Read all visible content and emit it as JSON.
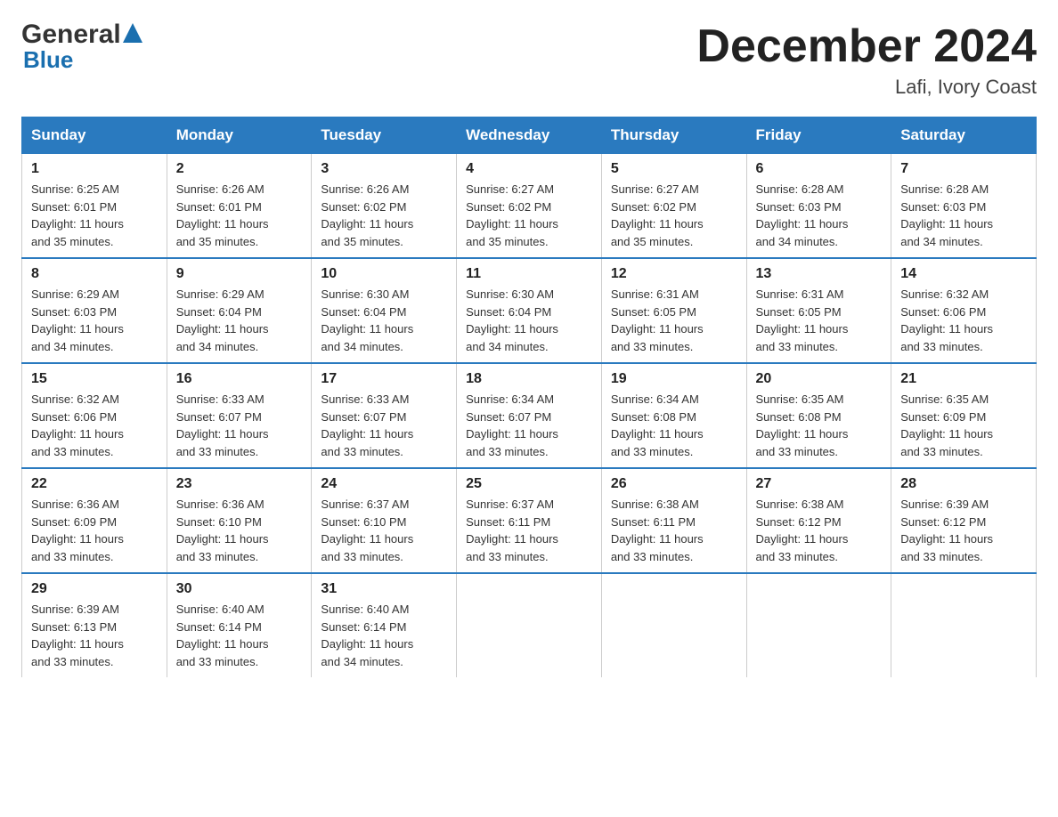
{
  "header": {
    "logo_general": "General",
    "logo_blue": "Blue",
    "month_title": "December 2024",
    "location": "Lafi, Ivory Coast"
  },
  "days_of_week": [
    "Sunday",
    "Monday",
    "Tuesday",
    "Wednesday",
    "Thursday",
    "Friday",
    "Saturday"
  ],
  "weeks": [
    [
      {
        "num": "1",
        "sunrise": "6:25 AM",
        "sunset": "6:01 PM",
        "daylight": "11 hours and 35 minutes."
      },
      {
        "num": "2",
        "sunrise": "6:26 AM",
        "sunset": "6:01 PM",
        "daylight": "11 hours and 35 minutes."
      },
      {
        "num": "3",
        "sunrise": "6:26 AM",
        "sunset": "6:02 PM",
        "daylight": "11 hours and 35 minutes."
      },
      {
        "num": "4",
        "sunrise": "6:27 AM",
        "sunset": "6:02 PM",
        "daylight": "11 hours and 35 minutes."
      },
      {
        "num": "5",
        "sunrise": "6:27 AM",
        "sunset": "6:02 PM",
        "daylight": "11 hours and 35 minutes."
      },
      {
        "num": "6",
        "sunrise": "6:28 AM",
        "sunset": "6:03 PM",
        "daylight": "11 hours and 34 minutes."
      },
      {
        "num": "7",
        "sunrise": "6:28 AM",
        "sunset": "6:03 PM",
        "daylight": "11 hours and 34 minutes."
      }
    ],
    [
      {
        "num": "8",
        "sunrise": "6:29 AM",
        "sunset": "6:03 PM",
        "daylight": "11 hours and 34 minutes."
      },
      {
        "num": "9",
        "sunrise": "6:29 AM",
        "sunset": "6:04 PM",
        "daylight": "11 hours and 34 minutes."
      },
      {
        "num": "10",
        "sunrise": "6:30 AM",
        "sunset": "6:04 PM",
        "daylight": "11 hours and 34 minutes."
      },
      {
        "num": "11",
        "sunrise": "6:30 AM",
        "sunset": "6:04 PM",
        "daylight": "11 hours and 34 minutes."
      },
      {
        "num": "12",
        "sunrise": "6:31 AM",
        "sunset": "6:05 PM",
        "daylight": "11 hours and 33 minutes."
      },
      {
        "num": "13",
        "sunrise": "6:31 AM",
        "sunset": "6:05 PM",
        "daylight": "11 hours and 33 minutes."
      },
      {
        "num": "14",
        "sunrise": "6:32 AM",
        "sunset": "6:06 PM",
        "daylight": "11 hours and 33 minutes."
      }
    ],
    [
      {
        "num": "15",
        "sunrise": "6:32 AM",
        "sunset": "6:06 PM",
        "daylight": "11 hours and 33 minutes."
      },
      {
        "num": "16",
        "sunrise": "6:33 AM",
        "sunset": "6:07 PM",
        "daylight": "11 hours and 33 minutes."
      },
      {
        "num": "17",
        "sunrise": "6:33 AM",
        "sunset": "6:07 PM",
        "daylight": "11 hours and 33 minutes."
      },
      {
        "num": "18",
        "sunrise": "6:34 AM",
        "sunset": "6:07 PM",
        "daylight": "11 hours and 33 minutes."
      },
      {
        "num": "19",
        "sunrise": "6:34 AM",
        "sunset": "6:08 PM",
        "daylight": "11 hours and 33 minutes."
      },
      {
        "num": "20",
        "sunrise": "6:35 AM",
        "sunset": "6:08 PM",
        "daylight": "11 hours and 33 minutes."
      },
      {
        "num": "21",
        "sunrise": "6:35 AM",
        "sunset": "6:09 PM",
        "daylight": "11 hours and 33 minutes."
      }
    ],
    [
      {
        "num": "22",
        "sunrise": "6:36 AM",
        "sunset": "6:09 PM",
        "daylight": "11 hours and 33 minutes."
      },
      {
        "num": "23",
        "sunrise": "6:36 AM",
        "sunset": "6:10 PM",
        "daylight": "11 hours and 33 minutes."
      },
      {
        "num": "24",
        "sunrise": "6:37 AM",
        "sunset": "6:10 PM",
        "daylight": "11 hours and 33 minutes."
      },
      {
        "num": "25",
        "sunrise": "6:37 AM",
        "sunset": "6:11 PM",
        "daylight": "11 hours and 33 minutes."
      },
      {
        "num": "26",
        "sunrise": "6:38 AM",
        "sunset": "6:11 PM",
        "daylight": "11 hours and 33 minutes."
      },
      {
        "num": "27",
        "sunrise": "6:38 AM",
        "sunset": "6:12 PM",
        "daylight": "11 hours and 33 minutes."
      },
      {
        "num": "28",
        "sunrise": "6:39 AM",
        "sunset": "6:12 PM",
        "daylight": "11 hours and 33 minutes."
      }
    ],
    [
      {
        "num": "29",
        "sunrise": "6:39 AM",
        "sunset": "6:13 PM",
        "daylight": "11 hours and 33 minutes."
      },
      {
        "num": "30",
        "sunrise": "6:40 AM",
        "sunset": "6:14 PM",
        "daylight": "11 hours and 33 minutes."
      },
      {
        "num": "31",
        "sunrise": "6:40 AM",
        "sunset": "6:14 PM",
        "daylight": "11 hours and 34 minutes."
      },
      null,
      null,
      null,
      null
    ]
  ],
  "labels": {
    "sunrise": "Sunrise:",
    "sunset": "Sunset:",
    "daylight": "Daylight:"
  }
}
